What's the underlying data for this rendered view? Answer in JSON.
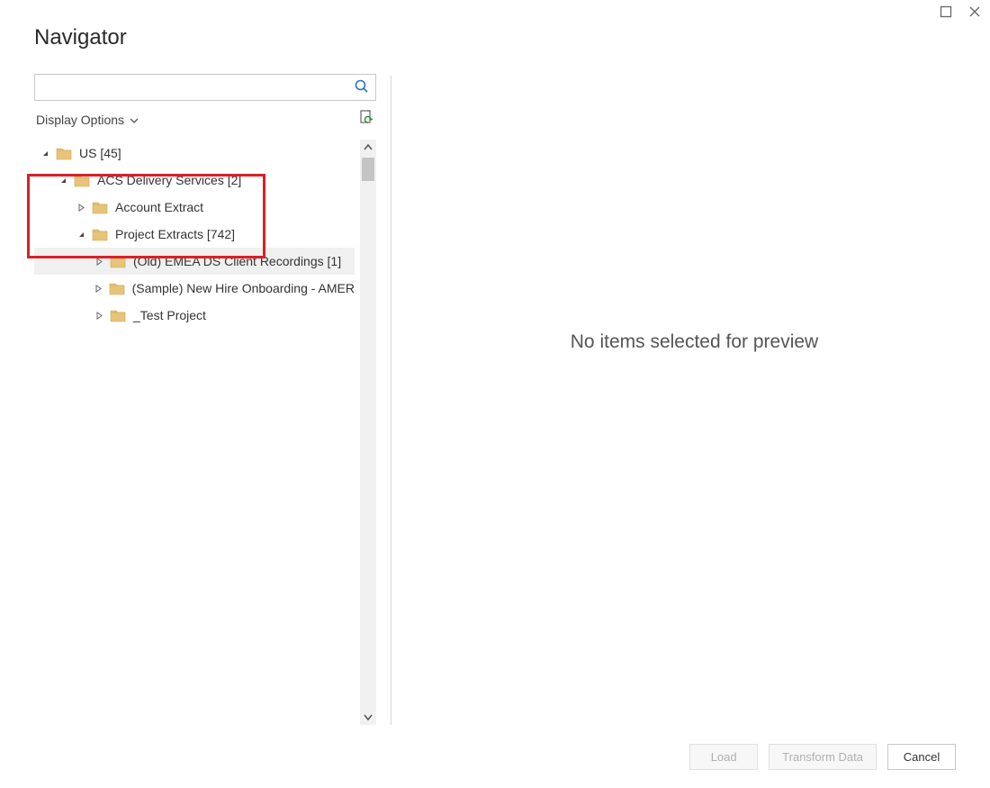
{
  "window": {
    "title": "Navigator"
  },
  "search": {
    "placeholder": ""
  },
  "display_options_label": "Display Options",
  "tree": {
    "items": [
      {
        "level": 1,
        "expanded": true,
        "label": "US [45]"
      },
      {
        "level": 2,
        "expanded": true,
        "label": "ACS Delivery Services [2]"
      },
      {
        "level": 3,
        "expanded": false,
        "label": "Account Extract"
      },
      {
        "level": 3,
        "expanded": true,
        "label": "Project Extracts [742]"
      },
      {
        "level": 4,
        "expanded": false,
        "label": "(Old) EMEA DS Client Recordings [1]",
        "selected": true
      },
      {
        "level": 4,
        "expanded": false,
        "label": "(Sample) New Hire Onboarding - AMER"
      },
      {
        "level": 4,
        "expanded": false,
        "label": "_Test Project"
      }
    ]
  },
  "preview_message": "No items selected for preview",
  "buttons": {
    "load": "Load",
    "transform": "Transform Data",
    "cancel": "Cancel"
  }
}
